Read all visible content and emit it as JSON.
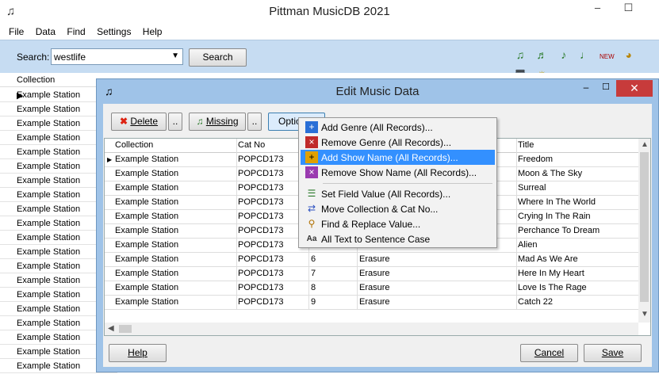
{
  "app": {
    "title": "Pittman MusicDB 2021",
    "menu": [
      "File",
      "Data",
      "Find",
      "Settings",
      "Help"
    ],
    "search_label": "Search:",
    "search_value": "westlife",
    "search_button": "Search"
  },
  "background": {
    "header_collection": "Collection",
    "rows": [
      "Example Station",
      "Example Station",
      "Example Station",
      "Example Station",
      "Example Station",
      "Example Station",
      "Example Station",
      "Example Station",
      "Example Station",
      "Example Station",
      "Example Station",
      "Example Station",
      "Example Station",
      "Example Station",
      "Example Station",
      "Example Station",
      "Example Station",
      "Example Station",
      "Example Station",
      "Example Station"
    ]
  },
  "dialog": {
    "title": "Edit Music Data",
    "delete_button": "Delete",
    "missing_button": "Missing",
    "options_button": "Options",
    "ellipsis": "..",
    "help_button": "Help",
    "cancel_button": "Cancel",
    "save_button": "Save",
    "grid": {
      "headers": [
        "Collection",
        "Cat No",
        "Title"
      ],
      "rows": [
        {
          "collection": "Example Station",
          "catno": "POPCD173",
          "track": "",
          "artist": "",
          "title": "Freedom"
        },
        {
          "collection": "Example Station",
          "catno": "POPCD173",
          "track": "",
          "artist": "",
          "title": "Moon & The Sky"
        },
        {
          "collection": "Example Station",
          "catno": "POPCD173",
          "track": "",
          "artist": "",
          "title": "Surreal"
        },
        {
          "collection": "Example Station",
          "catno": "POPCD173",
          "track": "",
          "artist": "",
          "title": "Where In The World"
        },
        {
          "collection": "Example Station",
          "catno": "POPCD173",
          "track": "",
          "artist": "",
          "title": "Crying In The Rain"
        },
        {
          "collection": "Example Station",
          "catno": "POPCD173",
          "track": "",
          "artist": "",
          "title": "Perchance To Dream"
        },
        {
          "collection": "Example Station",
          "catno": "POPCD173",
          "track": "",
          "artist": "",
          "title": "Alien"
        },
        {
          "collection": "Example Station",
          "catno": "POPCD173",
          "track": "6",
          "artist": "Erasure",
          "title": "Mad As We Are"
        },
        {
          "collection": "Example Station",
          "catno": "POPCD173",
          "track": "7",
          "artist": "Erasure",
          "title": "Here In My Heart"
        },
        {
          "collection": "Example Station",
          "catno": "POPCD173",
          "track": "8",
          "artist": "Erasure",
          "title": "Love Is The Rage"
        },
        {
          "collection": "Example Station",
          "catno": "POPCD173",
          "track": "9",
          "artist": "Erasure",
          "title": "Catch 22"
        }
      ]
    }
  },
  "options_menu": {
    "items": [
      {
        "label": "Add Genre (All Records)...",
        "icon": "add-genre-icon"
      },
      {
        "label": "Remove Genre (All Records)...",
        "icon": "remove-genre-icon"
      },
      {
        "label": "Add Show Name (All Records)...",
        "icon": "add-show-icon",
        "selected": true
      },
      {
        "label": "Remove Show Name (All Records)...",
        "icon": "remove-show-icon"
      },
      {
        "label": "Set Field Value (All Records)...",
        "icon": "set-field-icon"
      },
      {
        "label": "Move Collection & Cat No...",
        "icon": "move-collection-icon"
      },
      {
        "label": "Find & Replace Value...",
        "icon": "find-replace-icon"
      },
      {
        "label": "All Text to Sentence Case",
        "icon": "sentence-case-icon"
      }
    ]
  },
  "colors": {
    "toolbar_bg": "#c6dcf2",
    "dialog_frame": "#9fc3e8",
    "menu_highlight": "#3390ff",
    "close_button": "#c73b3b"
  }
}
